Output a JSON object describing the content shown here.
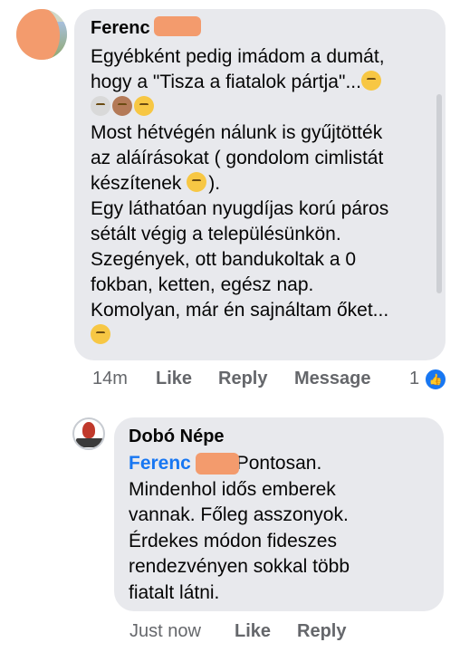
{
  "comment": {
    "author": "Ferenc",
    "lines": [
      "Egyébként pedig imádom a dumát,",
      "hogy a \"Tisza a fiatalok pártja\"...",
      "",
      "Most hétvégén nálunk is gyűjtötték",
      "az aláírásokat ( gondolom cimlistát",
      "készítenek",
      "Egy láthatóan nyugdíjas korú páros",
      "sétált végig a településünkön.",
      "Szegények, ott bandukoltak a 0",
      "fokban, ketten, egész nap.",
      "Komolyan, már én sajnáltam őket...",
      ""
    ],
    "line6_suffix": ").",
    "emoji": [
      "flushed-face",
      "eye-roll-face",
      "person-facepalm",
      "thinking-face",
      "thinking-face",
      "confused-face"
    ],
    "time": "14m",
    "like_label": "Like",
    "reply_label": "Reply",
    "message_label": "Message",
    "reaction_count": "1",
    "colors": {
      "bubble": "#e8e9ed",
      "meta": "#65676b",
      "like_blue": "#1877f2"
    }
  },
  "reply": {
    "author": "Dobó Népe",
    "mention": "Ferenc",
    "lines": [
      "Pontosan.",
      "Mindenhol idős emberek",
      "vannak. Főleg asszonyok.",
      "Érdekes módon fideszes",
      "rendezvényen sokkal több",
      "fiatalt látni."
    ],
    "time": "Just now",
    "like_label": "Like",
    "reply_label": "Reply"
  }
}
